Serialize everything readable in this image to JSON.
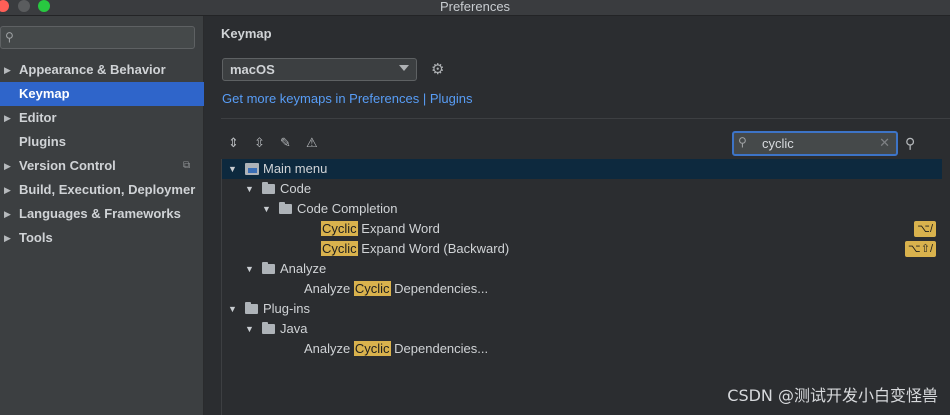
{
  "window": {
    "title": "Preferences"
  },
  "sidebar": {
    "search": {
      "placeholder": ""
    },
    "items": [
      {
        "label": "Appearance & Behavior",
        "expandable": true
      },
      {
        "label": "Keymap",
        "expandable": false,
        "selected": true
      },
      {
        "label": "Editor",
        "expandable": true
      },
      {
        "label": "Plugins",
        "expandable": false
      },
      {
        "label": "Version Control",
        "expandable": true
      },
      {
        "label": "Build, Execution, Deploymer",
        "expandable": true
      },
      {
        "label": "Languages & Frameworks",
        "expandable": true
      },
      {
        "label": "Tools",
        "expandable": true
      }
    ]
  },
  "main": {
    "title": "Keymap",
    "keymap_select": {
      "value": "macOS"
    },
    "link": "Get more keymaps in Preferences | Plugins",
    "search": {
      "value": "cyclic"
    },
    "tree": [
      {
        "parts": [
          {
            "t": "Main menu",
            "h": false
          }
        ],
        "kind": "menu",
        "expanded": true,
        "selected": true
      },
      {
        "parts": [
          {
            "t": "Code",
            "h": false
          }
        ],
        "kind": "folder",
        "expanded": true
      },
      {
        "parts": [
          {
            "t": "Code Completion",
            "h": false
          }
        ],
        "kind": "folder",
        "expanded": true
      },
      {
        "parts": [
          {
            "t": "Cyclic",
            "h": true
          },
          {
            "t": " Expand Word",
            "h": false
          }
        ],
        "kind": "action",
        "shortcut": "⌥/"
      },
      {
        "parts": [
          {
            "t": "Cyclic",
            "h": true
          },
          {
            "t": " Expand Word (Backward)",
            "h": false
          }
        ],
        "kind": "action",
        "shortcut": "⌥⇧/"
      },
      {
        "parts": [
          {
            "t": "Analyze",
            "h": false
          }
        ],
        "kind": "folder",
        "expanded": true
      },
      {
        "parts": [
          {
            "t": "Analyze ",
            "h": false
          },
          {
            "t": "Cyclic",
            "h": true
          },
          {
            "t": " Dependencies...",
            "h": false
          }
        ],
        "kind": "action"
      },
      {
        "parts": [
          {
            "t": "Plug-ins",
            "h": false
          }
        ],
        "kind": "folder",
        "expanded": true
      },
      {
        "parts": [
          {
            "t": "Java",
            "h": false
          }
        ],
        "kind": "folder",
        "expanded": true
      },
      {
        "parts": [
          {
            "t": "Analyze ",
            "h": false
          },
          {
            "t": "Cyclic",
            "h": true
          },
          {
            "t": " Dependencies...",
            "h": false
          }
        ],
        "kind": "action"
      }
    ]
  },
  "watermark": "CSDN @测试开发小白变怪兽",
  "colors": {
    "selection": "#2f65ca",
    "highlight": "#d9b24d",
    "link": "#589df6",
    "tree_selection": "#0d293e"
  }
}
